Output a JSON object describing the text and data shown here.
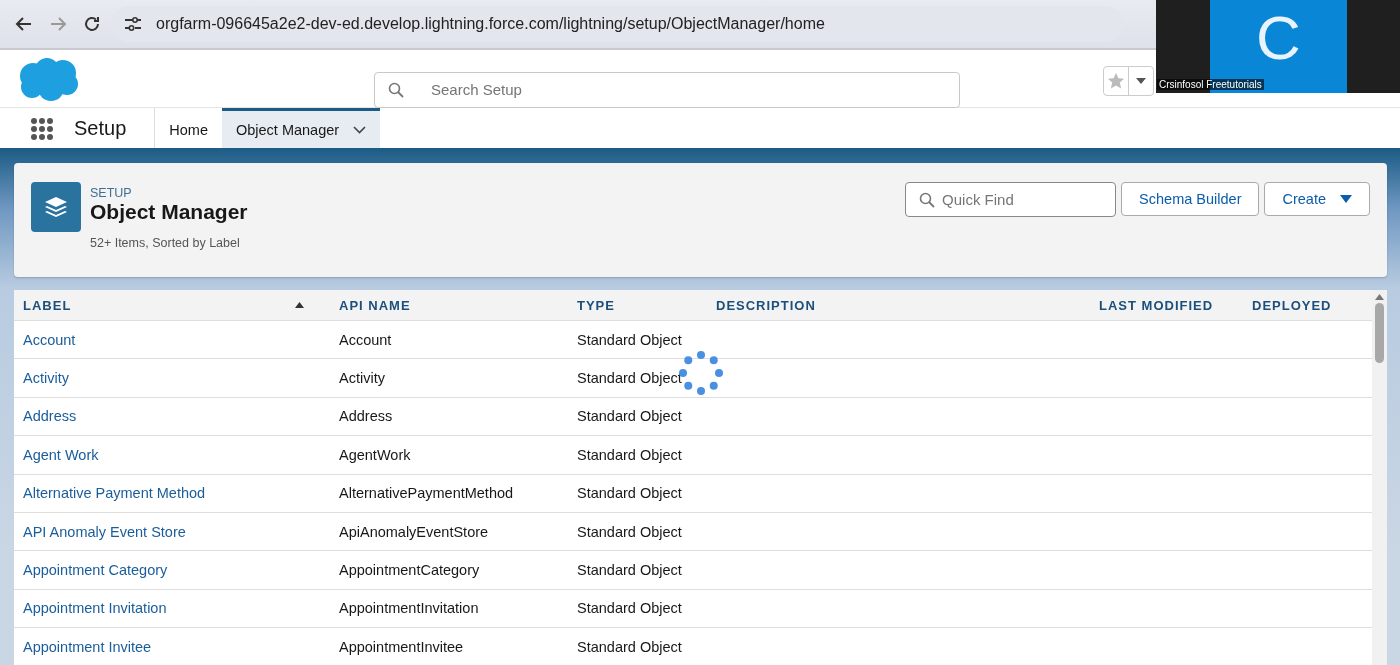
{
  "browser": {
    "url": "orgfarm-096645a2e2-dev-ed.develop.lightning.force.com/lightning/setup/ObjectManager/home"
  },
  "video_tile": {
    "initial": "C",
    "name": "Crsinfosol Freetutorials"
  },
  "header": {
    "search": {
      "placeholder": "Search Setup"
    }
  },
  "nav": {
    "app_name": "Setup",
    "tabs": [
      {
        "label": "Home",
        "selected": false,
        "menu": false
      },
      {
        "label": "Object Manager",
        "selected": true,
        "menu": true
      }
    ]
  },
  "page_header": {
    "eyebrow": "SETUP",
    "title": "Object Manager",
    "subtitle": "52+ Items, Sorted by Label",
    "quick_find": {
      "placeholder": "Quick Find"
    },
    "buttons": [
      {
        "label": "Schema Builder",
        "menu": false
      },
      {
        "label": "Create",
        "menu": true
      }
    ]
  },
  "table": {
    "columns": [
      {
        "label": "LABEL",
        "sorted": true
      },
      {
        "label": "API NAME",
        "sorted": false
      },
      {
        "label": "TYPE",
        "sorted": false
      },
      {
        "label": "DESCRIPTION",
        "sorted": false
      },
      {
        "label": "LAST MODIFIED",
        "sorted": false
      },
      {
        "label": "DEPLOYED",
        "sorted": false
      }
    ],
    "loading": true,
    "rows": [
      {
        "label": "Account",
        "api_name": "Account",
        "type": "Standard Object"
      },
      {
        "label": "Activity",
        "api_name": "Activity",
        "type": "Standard Object"
      },
      {
        "label": "Address",
        "api_name": "Address",
        "type": "Standard Object"
      },
      {
        "label": "Agent Work",
        "api_name": "AgentWork",
        "type": "Standard Object"
      },
      {
        "label": "Alternative Payment Method",
        "api_name": "AlternativePaymentMethod",
        "type": "Standard Object"
      },
      {
        "label": "API Anomaly Event Store",
        "api_name": "ApiAnomalyEventStore",
        "type": "Standard Object"
      },
      {
        "label": "Appointment Category",
        "api_name": "AppointmentCategory",
        "type": "Standard Object"
      },
      {
        "label": "Appointment Invitation",
        "api_name": "AppointmentInvitation",
        "type": "Standard Object"
      },
      {
        "label": "Appointment Invitee",
        "api_name": "AppointmentInvitee",
        "type": "Standard Object"
      }
    ]
  }
}
